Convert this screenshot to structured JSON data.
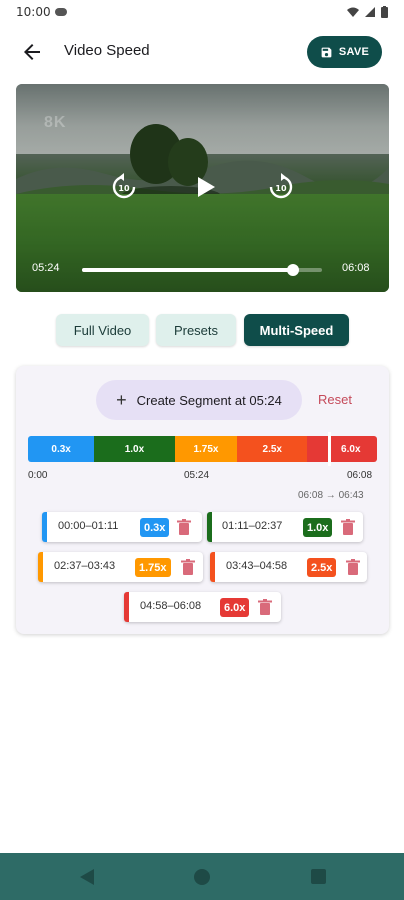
{
  "status": {
    "time": "10:00"
  },
  "app_bar": {
    "title": "Video Speed",
    "save_label": "SAVE"
  },
  "video": {
    "watermark": "8K",
    "current_time": "05:24",
    "total_time": "06:08",
    "progress": 0.88
  },
  "tabs": [
    {
      "label": "Full Video",
      "active": false
    },
    {
      "label": "Presets",
      "active": false
    },
    {
      "label": "Multi-Speed",
      "active": true
    }
  ],
  "multi_speed": {
    "create_label": "Create Segment at 05:24",
    "reset_label": "Reset",
    "timeline": {
      "segments": [
        {
          "label": "0.3x",
          "color": "#2196f3",
          "fraction": 0.19
        },
        {
          "label": "1.0x",
          "color": "#1b6d1c",
          "fraction": 0.23
        },
        {
          "label": "1.75x",
          "color": "#ff9800",
          "fraction": 0.18
        },
        {
          "label": "2.5x",
          "color": "#f4511e",
          "fraction": 0.2
        },
        {
          "label": "",
          "color": "#e53935",
          "fraction": 0.05
        },
        {
          "label": "6.0x",
          "color": "#e53935",
          "fraction": 0.15
        }
      ],
      "start_label": "0:00",
      "current_label": "05:24",
      "end_label": "06:08",
      "range_label": "06:08 → 06:43"
    },
    "segment_chips": [
      {
        "range": "00:00–01:11",
        "speed": "0.3x",
        "color": "#2196f3"
      },
      {
        "range": "01:11–02:37",
        "speed": "1.0x",
        "color": "#1b6d1c"
      },
      {
        "range": "02:37–03:43",
        "speed": "1.75x",
        "color": "#ff9800"
      },
      {
        "range": "03:43–04:58",
        "speed": "2.5x",
        "color": "#f4511e"
      },
      {
        "range": "04:58–06:08",
        "speed": "6.0x",
        "color": "#e53935"
      }
    ]
  },
  "colors": {
    "primary": "#0f4d4a",
    "tab_light": "#dff0ec",
    "nav_bar": "#2e6b66",
    "reset": "#c54a5a"
  }
}
